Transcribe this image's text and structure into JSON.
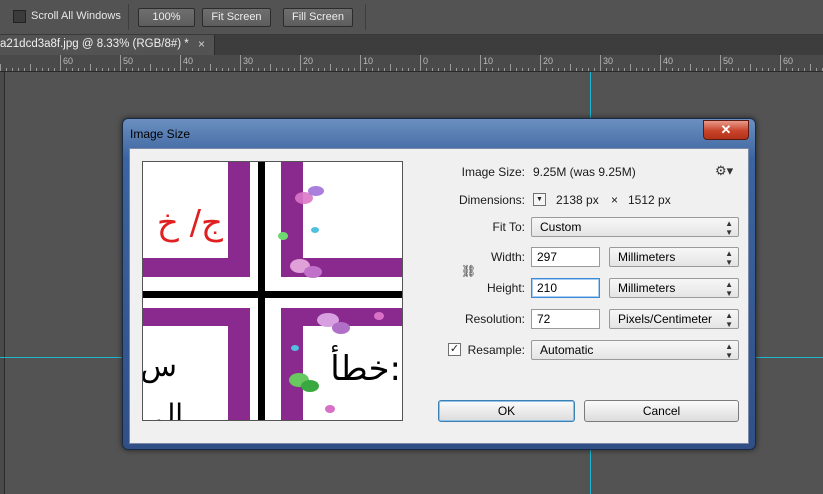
{
  "options_bar": {
    "scroll_all_windows_label": "Scroll All Windows",
    "zoom_100_label": "100%",
    "fit_screen_label": "Fit Screen",
    "fill_screen_label": "Fill Screen"
  },
  "document_tab": {
    "title": "a21dcd3a8f.jpg @ 8.33% (RGB/8#) *",
    "close_glyph": "×"
  },
  "ruler": {
    "labels": [
      "60",
      "50",
      "40",
      "30",
      "20",
      "10",
      "0",
      "10",
      "20",
      "30",
      "40",
      "50",
      "60"
    ]
  },
  "dialog": {
    "title": "Image Size",
    "close_glyph": "✕",
    "image_size_label": "Image Size:",
    "image_size_value": "9.25M (was 9.25M)",
    "dimensions_label": "Dimensions:",
    "dimensions_width": "2138 px",
    "dimensions_x": "×",
    "dimensions_height": "1512 px",
    "fit_to_label": "Fit To:",
    "fit_to_value": "Custom",
    "width_label": "Width:",
    "width_value": "297",
    "width_unit": "Millimeters",
    "height_label": "Height:",
    "height_value": "210",
    "height_unit": "Millimeters",
    "resolution_label": "Resolution:",
    "resolution_value": "72",
    "resolution_unit": "Pixels/Centimeter",
    "resample_label": "Resample:",
    "resample_checked": true,
    "resample_value": "Automatic",
    "ok_label": "OK",
    "cancel_label": "Cancel"
  },
  "preview": {
    "text_top_left": "ج/ خ",
    "text_mid_left": "س",
    "text_bottom_right": "خطأ:",
    "text_bottom_left": "ال"
  },
  "colors": {
    "canvas_bg": "#535353",
    "guide": "#1fb6cf",
    "purple": "#8b2a8e",
    "red_text": "#e02020"
  }
}
